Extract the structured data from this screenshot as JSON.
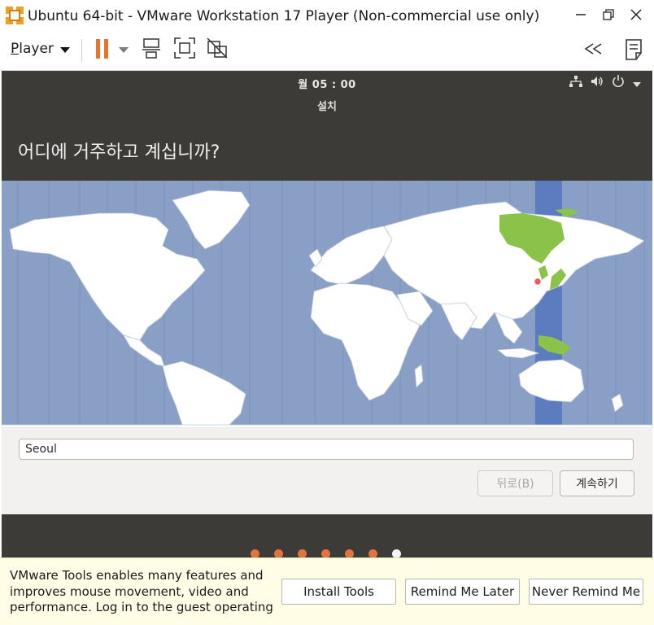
{
  "window": {
    "title": "Ubuntu 64-bit - VMware Workstation 17 Player (Non-commercial use only)",
    "logo_icon": "vmware-logo-icon",
    "controls": [
      "minimize-icon",
      "maximize-icon",
      "close-icon"
    ]
  },
  "toolbar": {
    "player_label_first": "P",
    "player_label_rest": "layer",
    "icons": [
      "dropdown-icon",
      "pause-icon",
      "send-ctrl-alt-del-icon",
      "fullscreen-icon",
      "unity-icon",
      "collapse-icon",
      "notes-icon"
    ],
    "pause_color": "#e8742a"
  },
  "guest": {
    "clock": "월 05 : 00",
    "system_icons": [
      "network-icon",
      "volume-icon",
      "power-icon",
      "chevron-down-icon"
    ],
    "installer": {
      "window_title": "설치",
      "question": "어디에 거주하고 계십니까?",
      "timezone_value": "Seoul",
      "back_label": "뒤로(B)",
      "continue_label": "계속하기",
      "selected_zone_color": "#8bc34a",
      "ocean_color": "#8a9fc5",
      "timezone_band_color": "#5b7cbf"
    },
    "progress": {
      "total": 7,
      "current": 7
    }
  },
  "tools_bar": {
    "message": "VMware Tools enables many features and improves mouse movement, video and performance. Log in to the guest operating",
    "install_label": "Install Tools",
    "remind_label": "Remind Me Later",
    "never_label": "Never Remind Me"
  }
}
